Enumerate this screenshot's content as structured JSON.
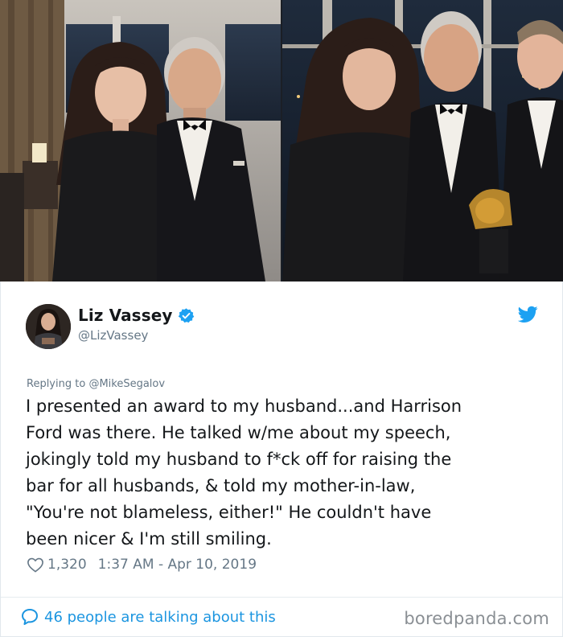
{
  "photos": [
    {
      "name": "left-photo"
    },
    {
      "name": "right-photo"
    }
  ],
  "tweet": {
    "display_name": "Liz Vassey",
    "handle": "@LizVassey",
    "replying_prefix": "Replying to ",
    "replying_to": "@MikeSegalov",
    "text": "I presented an award to my husband...and Harrison\nFord was there. He talked w/me about my speech,\njokingly told my husband to f*ck off for raising the\nbar for all husbands, & told my mother-in-law,\n\"You're not blameless, either!\" He couldn't have\nbeen nicer & I'm still smiling.",
    "like_count": "1,320",
    "timestamp": "1:37 AM - Apr 10, 2019",
    "talking_label": "46 people are talking about this",
    "verified": true
  },
  "watermark": "boredpanda.com",
  "icons": {
    "verified": "verified-badge-icon",
    "platform": "bird-logo-icon",
    "like": "heart-icon",
    "conversation": "speech-bubble-icon"
  },
  "colors": {
    "accent_blue": "#1da1f2",
    "link_blue": "#1b95e0",
    "muted_text": "#657786",
    "primary_text": "#14171a"
  }
}
